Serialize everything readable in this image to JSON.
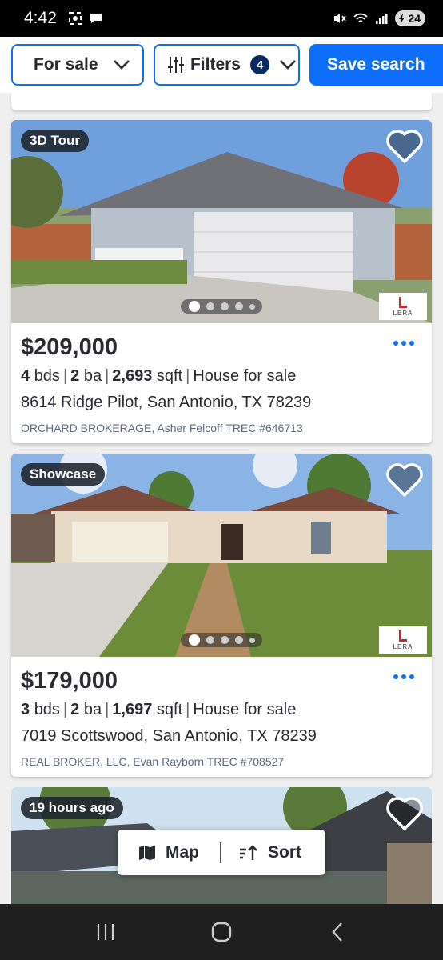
{
  "status_bar": {
    "time": "4:42",
    "battery": "24"
  },
  "top_bar": {
    "for_sale_label": "For sale",
    "filters_label": "Filters",
    "filters_count": "4",
    "save_search_label": "Save search"
  },
  "listings": [
    {
      "tag": "3D Tour",
      "price": "$209,000",
      "beds": "4",
      "beds_unit": "bds",
      "baths": "2",
      "baths_unit": "ba",
      "sqft": "2,693",
      "sqft_unit": "sqft",
      "type": "House for sale",
      "address": "8614 Ridge Pilot, San Antonio, TX 78239",
      "broker": "ORCHARD BROKERAGE, Asher Felcoff TREC #646713",
      "logo_text": "LERA"
    },
    {
      "tag": "Showcase",
      "price": "$179,000",
      "beds": "3",
      "beds_unit": "bds",
      "baths": "2",
      "baths_unit": "ba",
      "sqft": "1,697",
      "sqft_unit": "sqft",
      "type": "House for sale",
      "address": "7019 Scottswood, San Antonio, TX 78239",
      "broker": "REAL BROKER, LLC, Evan Rayborn TREC #708527",
      "logo_text": "LERA"
    },
    {
      "tag": "19 hours ago"
    }
  ],
  "floating_bar": {
    "map_label": "Map",
    "sort_label": "Sort"
  },
  "colors": {
    "accent": "#0d6efd",
    "badge": "#0a2a66",
    "text": "#2a2a33",
    "broker": "#596b82"
  }
}
